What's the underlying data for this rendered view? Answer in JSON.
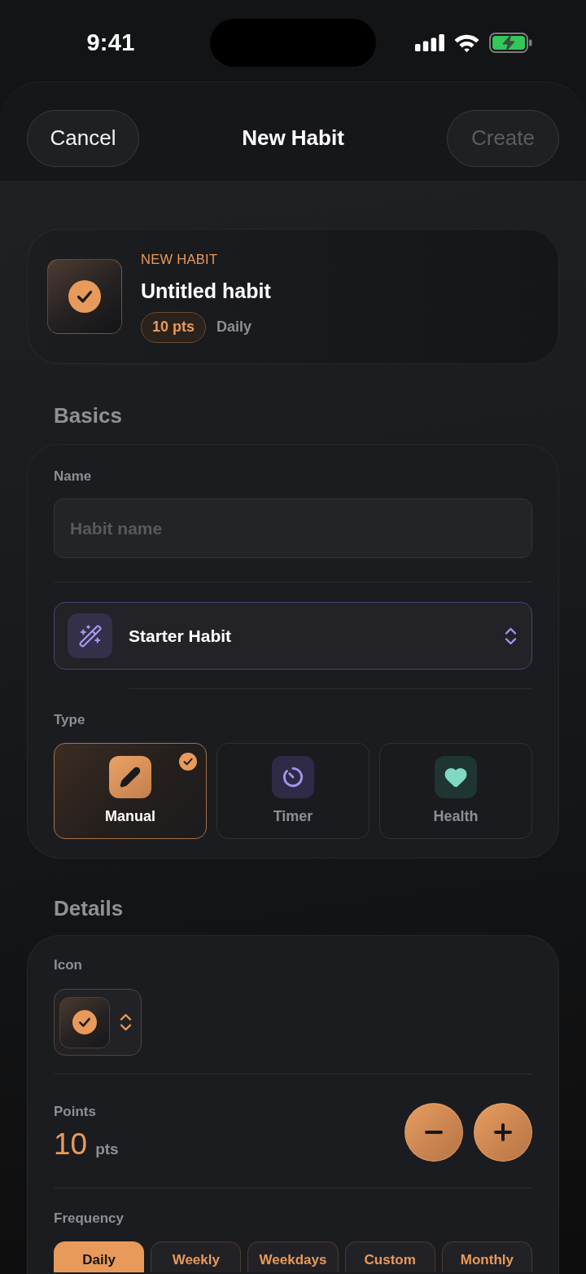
{
  "status_bar": {
    "time": "9:41"
  },
  "nav": {
    "cancel": "Cancel",
    "title": "New Habit",
    "create": {
      "label": "Create",
      "disabled": true
    }
  },
  "preview": {
    "eyebrow": "NEW HABIT",
    "title": "Untitled habit",
    "points": "10 pts",
    "frequency": "Daily"
  },
  "basics": {
    "heading": "Basics",
    "name_field": {
      "label": "Name",
      "placeholder": "Habit name"
    },
    "template": {
      "label": "Starter Habit"
    },
    "type_label": "Type",
    "types": [
      {
        "label": "Manual",
        "kind": "manual",
        "selected": true
      },
      {
        "label": "Timer",
        "kind": "timer",
        "selected": false
      },
      {
        "label": "Health",
        "kind": "health",
        "selected": false
      }
    ]
  },
  "details": {
    "heading": "Details",
    "icon_label": "Icon",
    "points": {
      "label": "Points",
      "value": "10",
      "unit": "pts"
    },
    "frequency": {
      "label": "Frequency",
      "options": [
        {
          "label": "Daily",
          "selected": true
        },
        {
          "label": "Weekly",
          "selected": false
        },
        {
          "label": "Weekdays",
          "selected": false
        },
        {
          "label": "Custom",
          "selected": false
        },
        {
          "label": "Monthly",
          "selected": false
        }
      ]
    }
  }
}
